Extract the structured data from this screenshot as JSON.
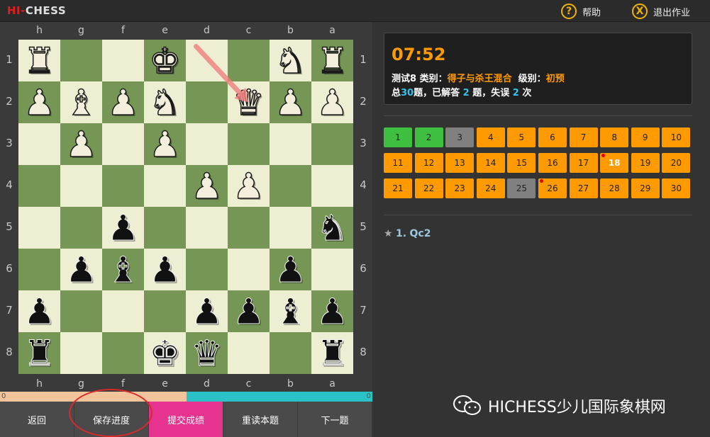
{
  "app": {
    "logo_hi": "HI-",
    "logo_rest": "CHESS"
  },
  "topbar": {
    "help_label": "帮助",
    "help_icon": "question-circle-icon",
    "exit_label": "退出作业",
    "exit_icon": "x-circle-icon"
  },
  "board": {
    "files": [
      "h",
      "g",
      "f",
      "e",
      "d",
      "c",
      "b",
      "a"
    ],
    "ranks": [
      "1",
      "2",
      "3",
      "4",
      "5",
      "6",
      "7",
      "8"
    ],
    "rows": [
      [
        "wR",
        "",
        "",
        "wK",
        "",
        "",
        "wN",
        "wR"
      ],
      [
        "wP",
        "wB",
        "wP",
        "wN",
        "",
        "wQ",
        "wP",
        "wP"
      ],
      [
        "",
        "wP",
        "",
        "wP",
        "",
        "",
        "",
        ""
      ],
      [
        "",
        "",
        "",
        "",
        "wP",
        "wP",
        "",
        ""
      ],
      [
        "",
        "",
        "bP",
        "",
        "",
        "",
        "",
        "bN"
      ],
      [
        "",
        "bP",
        "bB",
        "bP",
        "",
        "",
        "bP",
        ""
      ],
      [
        "bP",
        "",
        "",
        "",
        "bP",
        "bP",
        "bB",
        "bP"
      ],
      [
        "bR",
        "",
        "",
        "bK",
        "bQ",
        "",
        "",
        "bR"
      ]
    ],
    "arrow": {
      "from": "d1",
      "to": "c2",
      "color": "#f08080"
    }
  },
  "progress": {
    "left_value": "0",
    "right_value": "0",
    "fill_fraction": 0.5
  },
  "buttons": {
    "back": "返回",
    "save": "保存进度",
    "submit": "提交成绩",
    "reread": "重读本题",
    "next": "下一题"
  },
  "info": {
    "timer": "07:52",
    "test_label": "测试8",
    "category_label": "类别：",
    "category_value": "得子与杀王混合",
    "level_label": "级别：",
    "level_value": "初预",
    "total_prefix": "总",
    "total_value": "30",
    "total_mid": "题，已解答",
    "solved_value": "2",
    "solved_suffix": "题，失误",
    "mistakes_value": "2",
    "mistakes_suffix": "次"
  },
  "questions": [
    {
      "n": "1",
      "s": "done"
    },
    {
      "n": "2",
      "s": "done"
    },
    {
      "n": "3",
      "s": "skip"
    },
    {
      "n": "4",
      "s": "todo"
    },
    {
      "n": "5",
      "s": "todo"
    },
    {
      "n": "6",
      "s": "todo"
    },
    {
      "n": "7",
      "s": "todo"
    },
    {
      "n": "8",
      "s": "todo"
    },
    {
      "n": "9",
      "s": "todo"
    },
    {
      "n": "10",
      "s": "todo"
    },
    {
      "n": "11",
      "s": "todo"
    },
    {
      "n": "12",
      "s": "todo"
    },
    {
      "n": "13",
      "s": "todo"
    },
    {
      "n": "14",
      "s": "todo"
    },
    {
      "n": "15",
      "s": "todo"
    },
    {
      "n": "16",
      "s": "todo"
    },
    {
      "n": "17",
      "s": "todo"
    },
    {
      "n": "18",
      "s": "todo",
      "cur": true,
      "dot": true
    },
    {
      "n": "19",
      "s": "todo"
    },
    {
      "n": "20",
      "s": "todo"
    },
    {
      "n": "21",
      "s": "todo"
    },
    {
      "n": "22",
      "s": "todo"
    },
    {
      "n": "23",
      "s": "todo"
    },
    {
      "n": "24",
      "s": "todo"
    },
    {
      "n": "25",
      "s": "skip"
    },
    {
      "n": "26",
      "s": "todo",
      "dot": true
    },
    {
      "n": "27",
      "s": "todo"
    },
    {
      "n": "28",
      "s": "todo"
    },
    {
      "n": "29",
      "s": "todo"
    },
    {
      "n": "30",
      "s": "todo"
    }
  ],
  "moves": {
    "star": "★",
    "number": "1.",
    "move": "Qc2"
  },
  "watermark": {
    "text": "HICHESS少儿国际象棋网",
    "icon": "wechat-icon"
  },
  "colors": {
    "accent": "#ff9a00",
    "done": "#3fbf3f",
    "skip": "#808080",
    "submit": "#e5338f",
    "light_square": "#eeeed2",
    "dark_square": "#769656"
  }
}
